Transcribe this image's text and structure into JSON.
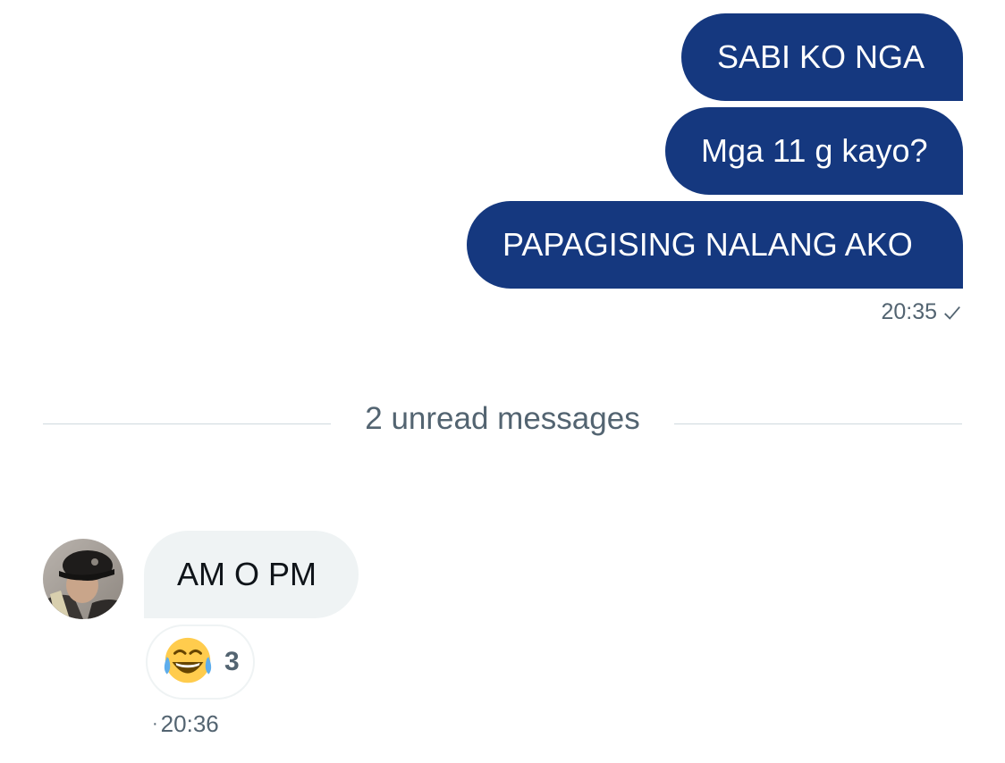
{
  "sent_messages": [
    {
      "text": "SABI KO NGA"
    },
    {
      "text": "Mga 11 g kayo?"
    },
    {
      "text": "PAPAGISING NALANG AKO"
    }
  ],
  "sent_meta": {
    "time": "20:35",
    "status_icon": "check-icon"
  },
  "divider": {
    "label": "2 unread messages"
  },
  "received": {
    "avatar_icon": "user-avatar",
    "message": "AM O PM",
    "reaction": {
      "emoji_icon": "face-with-tears-of-joy-icon",
      "count": "3"
    },
    "separator": "·",
    "time": "20:36"
  },
  "colors": {
    "sent_bubble": "#15387f",
    "received_bubble": "#eff3f4",
    "meta_text": "#536471",
    "divider": "#cfd9de"
  }
}
